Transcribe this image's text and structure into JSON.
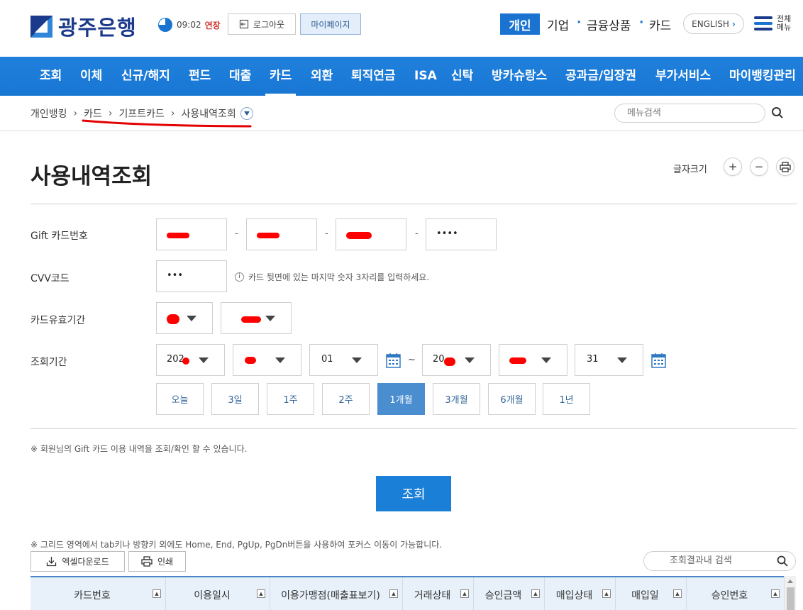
{
  "header": {
    "logo_text": "광주은행",
    "session_time": "09:02",
    "extend_label": "연장",
    "logout_label": "로그아웃",
    "mypage_label": "마이페이지",
    "segments": {
      "personal": "개인",
      "business": "기업",
      "financial": "금융상품",
      "card": "카드"
    },
    "english_label": "ENGLISH",
    "all_menu_label": "전체 메뉴",
    "brand_color": "#1a73d1"
  },
  "gnb": {
    "items": [
      "조회",
      "이체",
      "신규/해지",
      "펀드",
      "대출",
      "카드",
      "외환",
      "퇴직연금",
      "ISA",
      "신탁",
      "방카슈랑스",
      "공과금/입장권",
      "부가서비스",
      "마이뱅킹관리"
    ],
    "active": "카드"
  },
  "breadcrumb": {
    "items": [
      "개인뱅킹",
      "카드",
      "기프트카드",
      "사용내역조회"
    ]
  },
  "menu_search": {
    "placeholder": "메뉴검색"
  },
  "page": {
    "title": "사용내역조회",
    "font_size_label": "글자크기"
  },
  "form": {
    "card_number_label": "Gift 카드번호",
    "card_number_last": "••••",
    "cvv_label": "CVV코드",
    "cvv_value": "•••",
    "cvv_hint": "카드 뒷면에 있는 마지막 숫자 3자리를 입력하세요.",
    "expiry_label": "카드유효기간",
    "period_label": "조회기간",
    "start_year_prefix": "202",
    "start_day": "01",
    "end_year_prefix": "20",
    "end_day": "31",
    "tilde": "~",
    "period_buttons": [
      "오늘",
      "3일",
      "1주",
      "2주",
      "1개월",
      "3개월",
      "6개월",
      "1년"
    ],
    "period_active": "1개월"
  },
  "notice1": "※ 회원님의 Gift 카드 이용 내역을 조회/확인 할 수 있습니다.",
  "search_button": "조회",
  "notice2": "※ 그리드 영역에서 tab키나 방향키 외에도 Home, End, PgUp, PgDn버튼을 사용하여 포커스 이동이 가능합니다.",
  "toolbar": {
    "excel_label": "엑셀다운로드",
    "print_label": "인쇄",
    "result_search_placeholder": "조회결과내 검색"
  },
  "grid": {
    "columns": [
      "카드번호",
      "이용일시",
      "이용가맹점(매출표보기)",
      "거래상태",
      "승인금액",
      "매입상태",
      "매입일",
      "승인번호"
    ]
  }
}
